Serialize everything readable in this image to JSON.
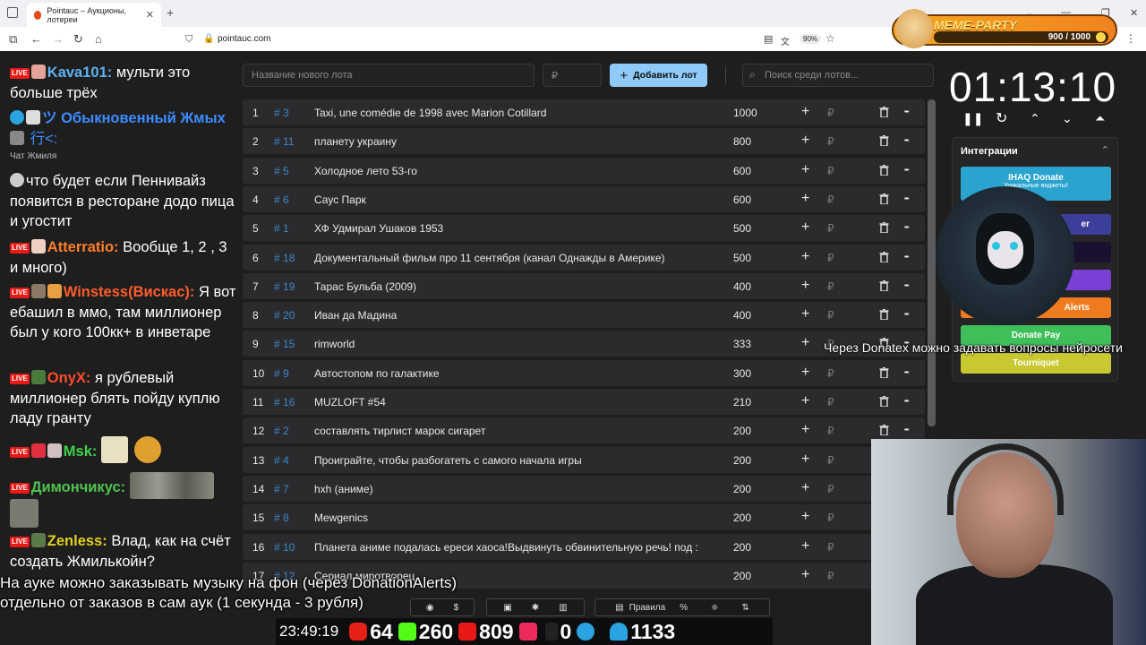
{
  "browser": {
    "tab_title": "Pointauc – Аукционы, лотереи",
    "url": "pointauc.com",
    "zoom": "90%"
  },
  "chat": [
    {
      "nick": "Kava101:",
      "text": " мульти это больше трёх",
      "color": "#5fb3f0"
    },
    {
      "nick": "ツ Обыкновенный Жмых",
      "text": " 行<:",
      "color": "#3b8cff"
    },
    {
      "sub": "Чат Жмиля"
    },
    {
      "text": "что будет если Пеннивайз появится в ресторане додо пица и угостит"
    },
    {
      "nick": "Atterratio:",
      "text": " Вообще 1, 2 , 3 и много)",
      "color": "#ff7f2a"
    },
    {
      "nick": "Winstess(Вискас):",
      "text": " Я вот ебашил в ммо, там миллионер был у кого 100кк+ в инветаре",
      "color": "#ff5c2a"
    },
    {
      "nick": "OnyX:",
      "text": " я рублевый миллионер блять пойду куплю ладу гранту",
      "color": "#ff4a2a"
    },
    {
      "nick": "Msk:",
      "text": "",
      "color": "#3fcf4a"
    },
    {
      "nick": "Димончикус:",
      "text": "",
      "color": "#4ec24e"
    },
    {
      "nick": "Zenless:",
      "text": " Влад, как на счёт создать Жмилькойн?",
      "color": "#e0d020"
    }
  ],
  "toolbar": {
    "new_lot_placeholder": "Название нового лота",
    "amount_placeholder": "₽",
    "add_button": "Добавить лот",
    "search_placeholder": "Поиск среди лотов..."
  },
  "lots": [
    {
      "n": "1",
      "id": "# 3",
      "name": "Taxi, une comédie de 1998 avec Marion Cotillard",
      "amount": "1000"
    },
    {
      "n": "2",
      "id": "# 11",
      "name": "планету украину",
      "amount": "800"
    },
    {
      "n": "3",
      "id": "# 5",
      "name": "Холодное лето 53-го",
      "amount": "600"
    },
    {
      "n": "4",
      "id": "# 6",
      "name": "Саус Парк",
      "amount": "600"
    },
    {
      "n": "5",
      "id": "# 1",
      "name": "ХФ Удмирал Ушаков 1953",
      "amount": "500"
    },
    {
      "n": "6",
      "id": "# 18",
      "name": "Документальный фильм про 11 сентября (канал Однажды в Америке)",
      "amount": "500"
    },
    {
      "n": "7",
      "id": "# 19",
      "name": "Тарас Бульба (2009)",
      "amount": "400"
    },
    {
      "n": "8",
      "id": "# 20",
      "name": "Иван да Мадина",
      "amount": "400"
    },
    {
      "n": "9",
      "id": "# 15",
      "name": "rimworld",
      "amount": "333"
    },
    {
      "n": "10",
      "id": "# 9",
      "name": "Автостопом по галактике",
      "amount": "300"
    },
    {
      "n": "11",
      "id": "# 16",
      "name": "MUZLOFT #54",
      "amount": "210"
    },
    {
      "n": "12",
      "id": "# 2",
      "name": "составлять тирлист марок сигарет",
      "amount": "200"
    },
    {
      "n": "13",
      "id": "# 4",
      "name": "Проиграйте, чтобы разбогатеть с самого начала игры",
      "amount": "200"
    },
    {
      "n": "14",
      "id": "# 7",
      "name": "hxh (аниме)",
      "amount": "200"
    },
    {
      "n": "15",
      "id": "# 8",
      "name": "Mewgenics",
      "amount": "200"
    },
    {
      "n": "16",
      "id": "# 10",
      "name": "Планета аниме подалась ереси хаоса!Выдвинуть обвинительную речь! под :",
      "amount": "200"
    },
    {
      "n": "17",
      "id": "# 12",
      "name": "Сериал миротворец",
      "amount": "200"
    }
  ],
  "currency": "₽",
  "timer": "01:13:10",
  "integrations": {
    "title": "Интеграции",
    "buttons": [
      {
        "label": "IHAQ Donate",
        "sub": "Уникальные виджеты!",
        "color": "#2aa3cf"
      },
      {
        "label": "er",
        "color": "#3c3f9a"
      },
      {
        "label": "",
        "color": "#1a1030"
      },
      {
        "label": "",
        "color": "#7b3fd6"
      },
      {
        "label": "Alerts",
        "color": "#f07a1e"
      },
      {
        "label": "Donate Pay",
        "color": "#3fbf5a"
      },
      {
        "label": "Tourniquet",
        "color": "#c8c830"
      }
    ]
  },
  "meme_party": {
    "title": "MEME-PARTY",
    "count": "900 / 1000",
    "progress": 0.9
  },
  "overlay": {
    "donatex": "Через Donatex можно задавать вопросы нейросети",
    "line1": "На ауке можно заказывать музыку на фон (через DonationAlerts)",
    "line2": "отдельно от заказов в сам аук (1 секунда - 3 рубля)"
  },
  "bottom_toolbar": {
    "rules": "Правила",
    "percent": "%"
  },
  "stats": {
    "clock": "23:49:19",
    "youtube": "64",
    "kick": "260",
    "live": "809",
    "other": "0",
    "telegram": "",
    "viewers": "1133"
  }
}
